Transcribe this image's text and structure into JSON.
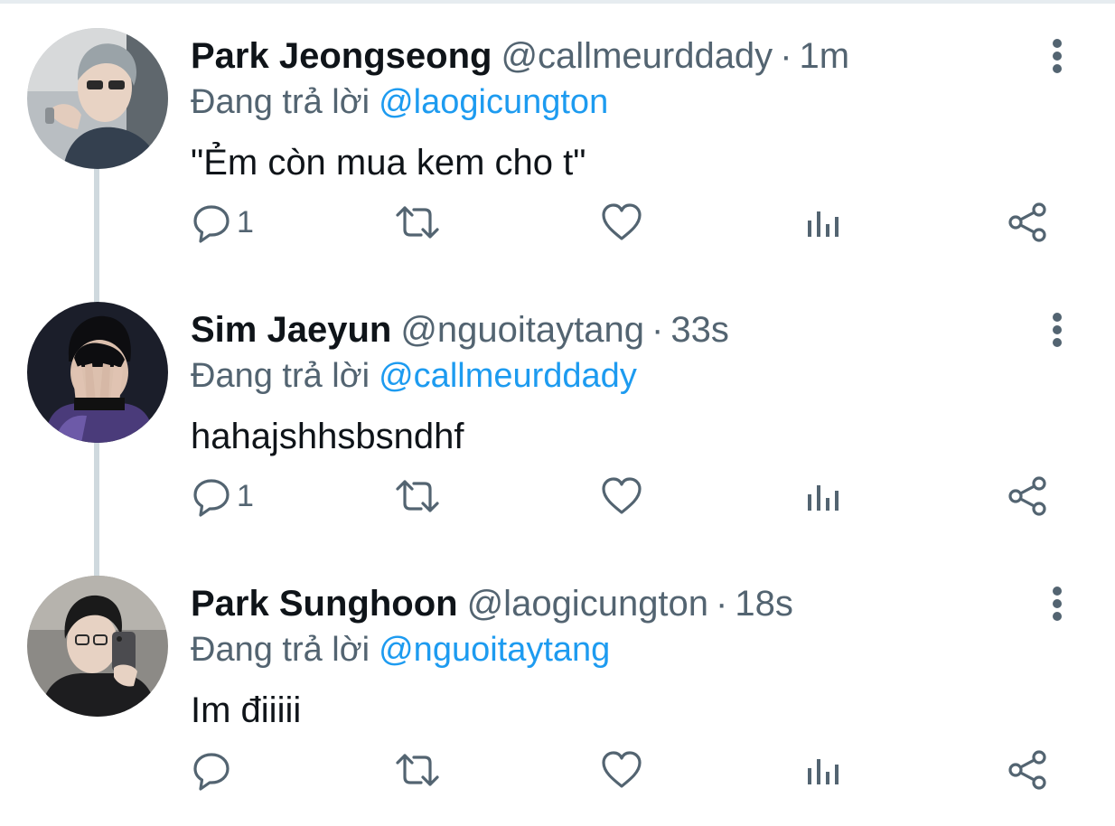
{
  "thread": {
    "tweets": [
      {
        "name": "Park Jeongseong",
        "handle": "@callmeurddady",
        "separator": "·",
        "time": "1m",
        "reply_prefix": "Đang trả lời",
        "reply_to": "@laogicungton",
        "text": "\"Ẻm còn mua kem cho t\"",
        "reply_count": "1",
        "avatar_icon": "person-sunglasses-photo"
      },
      {
        "name": "Sim Jaeyun",
        "handle": "@nguoitaytang",
        "separator": "·",
        "time": "33s",
        "reply_prefix": "Đang trả lời",
        "reply_to": "@callmeurddady",
        "text": "hahajshhsbsndhf",
        "reply_count": "1",
        "avatar_icon": "person-covering-face-photo"
      },
      {
        "name": "Park Sunghoon",
        "handle": "@laogicungton",
        "separator": "·",
        "time": "18s",
        "reply_prefix": "Đang trả lời",
        "reply_to": "@nguoitaytang",
        "text": "Im điiiii",
        "reply_count": "",
        "avatar_icon": "person-mirror-selfie-photo"
      }
    ],
    "icons": {
      "reply": "reply-bubble-icon",
      "retweet": "retweet-icon",
      "like": "heart-icon",
      "views": "views-bar-chart-icon",
      "share": "share-icon",
      "more": "more-vertical-icon"
    },
    "colors": {
      "text_primary": "#0f1419",
      "text_secondary": "#536471",
      "mention": "#1d9bf0",
      "thread_line": "#cfd9de"
    }
  }
}
